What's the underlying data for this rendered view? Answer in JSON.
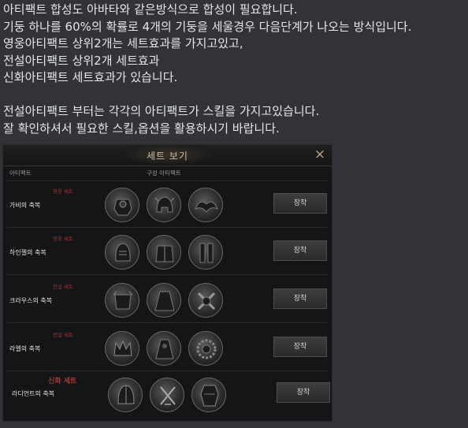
{
  "message": {
    "lines": [
      "아티팩트 합성도 아바타와 같은방식으로 합성이 필요합니다.",
      "기둥 하나를 60%의 확률로 4개의 기둥을 세울경우 다음단계가 나오는 방식입니다.",
      "영웅아티팩트 상위2개는 세트효과를 가지고있고,",
      "전설아티팩트 상위2개 세트효과",
      "신화아티팩트 세트효과가 있습니다.",
      "",
      "전설아티팩트 부터는 각각의 아티팩트가 스킬을 가지고있습니다.",
      "잘 확인하셔서 필요한 스킬,옵션을 활용하시기 바랍니다."
    ]
  },
  "panel": {
    "title": "세트 보기",
    "close_icon": "×",
    "col_artifact": "아티팩트",
    "col_components": "구성 아티팩트",
    "rows": [
      {
        "badge": "영웅 세트",
        "name": "가비의 축복",
        "equip": "장착",
        "icons": [
          "armor-piece-icon",
          "helmet-piece-icon",
          "wing-piece-icon"
        ]
      },
      {
        "badge": "영웅 세트",
        "name": "하인젤의 축복",
        "equip": "장착",
        "icons": [
          "helmet-piece-icon",
          "armor-piece-icon",
          "leg-armor-piece-icon"
        ]
      },
      {
        "badge": "전설 세트",
        "name": "크라우스의 축복",
        "equip": "장착",
        "icons": [
          "armor-piece-icon",
          "cloak-piece-icon",
          "weapon-piece-icon"
        ]
      },
      {
        "badge": "전설 세트",
        "name": "라엘의 축복",
        "equip": "장착",
        "icons": [
          "crown-piece-icon",
          "robe-piece-icon",
          "wreath-piece-icon"
        ]
      },
      {
        "badge": "신화 세트",
        "name": "라디언트의 축복",
        "equip": "장착",
        "icons": [
          "helmet-piece-icon",
          "sword-piece-icon",
          "full-armor-piece-icon"
        ]
      }
    ]
  },
  "colors": {
    "background": "#313338",
    "panel": "#141516",
    "badge_red": "#9b3a3a",
    "mythic_red": "#b53232",
    "title_gold": "#c9bea3"
  }
}
